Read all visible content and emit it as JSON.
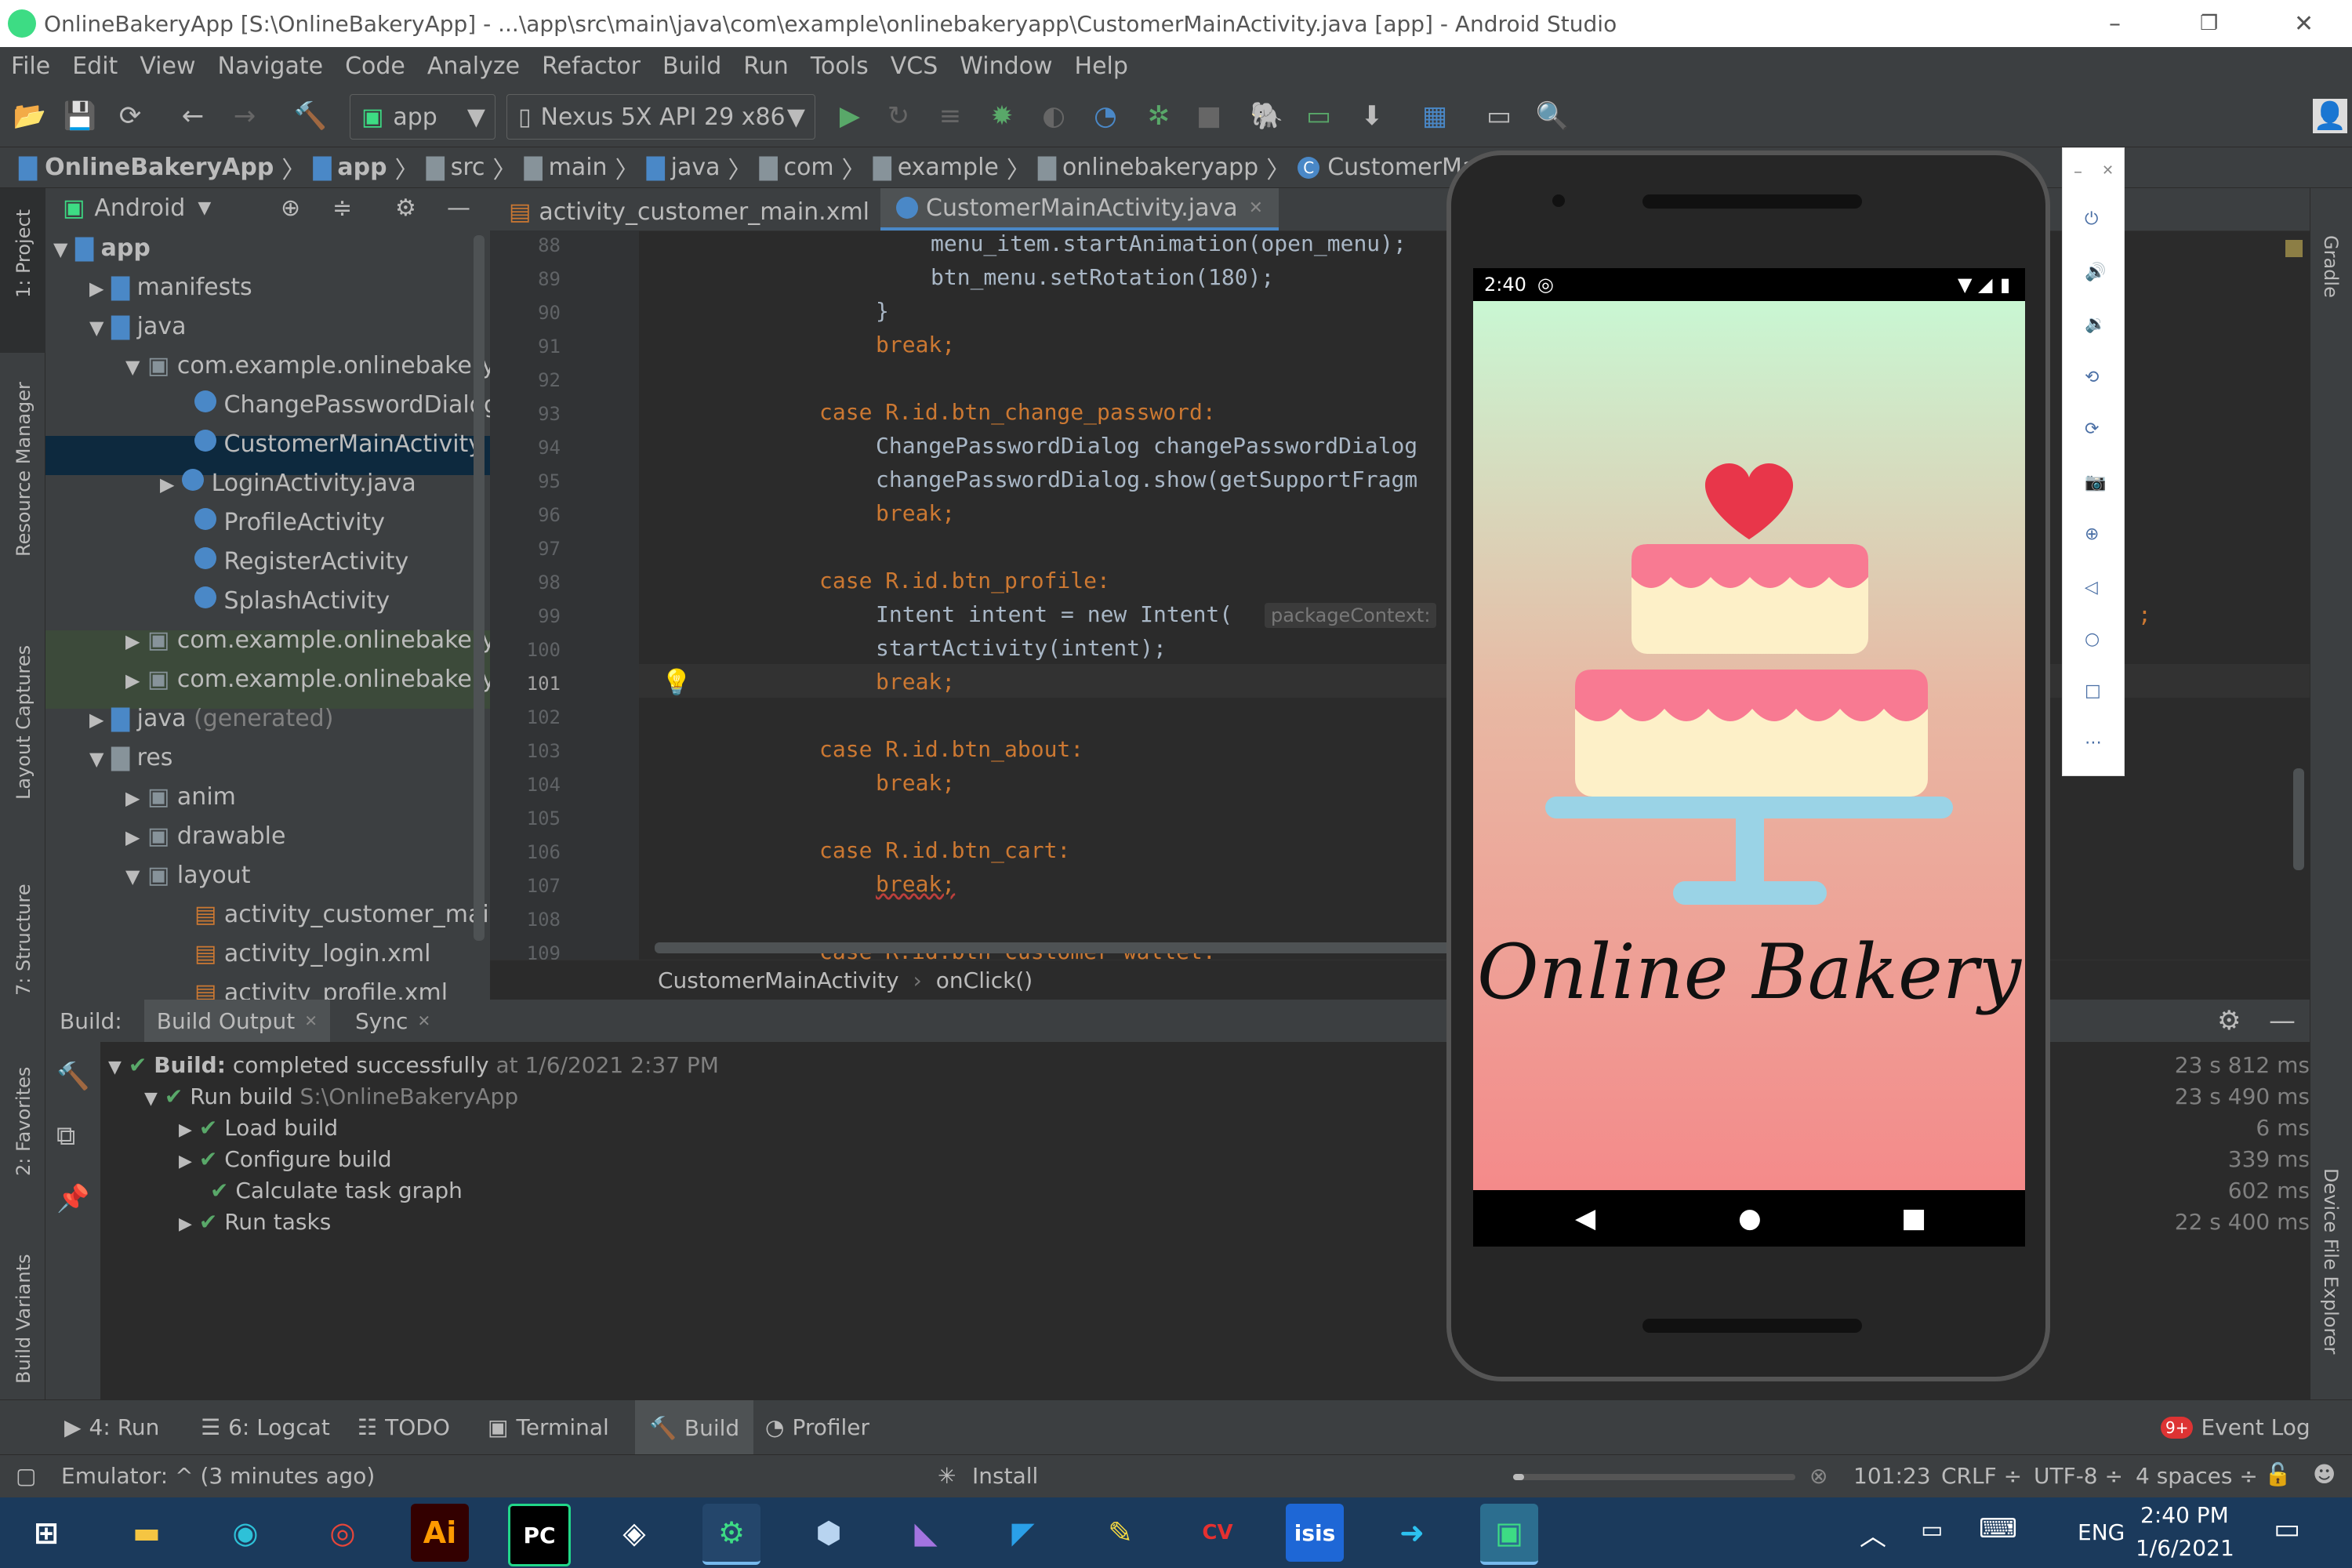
{
  "window": {
    "title": "OnlineBakeryApp [S:\\OnlineBakeryApp] - ...\\app\\src\\main\\java\\com\\example\\onlinebakeryapp\\CustomerMainActivity.java [app] - Android Studio",
    "minimize": "–",
    "maximize": "❐",
    "close": "✕"
  },
  "menu": [
    "File",
    "Edit",
    "View",
    "Navigate",
    "Code",
    "Analyze",
    "Refactor",
    "Build",
    "Run",
    "Tools",
    "VCS",
    "Window",
    "Help"
  ],
  "toolbar": {
    "config": "app",
    "device": "Nexus 5X API 29 x86"
  },
  "breadcrumb": [
    "OnlineBakeryApp",
    "app",
    "src",
    "main",
    "java",
    "com",
    "example",
    "onlinebakeryapp",
    "CustomerMainActivity"
  ],
  "project": {
    "view": "Android",
    "items": [
      {
        "label": "app"
      },
      {
        "label": "manifests"
      },
      {
        "label": "java"
      },
      {
        "label": "com.example.onlinebakeryap"
      },
      {
        "label": "ChangePasswordDialog"
      },
      {
        "label": "CustomerMainActivity"
      },
      {
        "label": "LoginActivity.java"
      },
      {
        "label": "ProfileActivity"
      },
      {
        "label": "RegisterActivity"
      },
      {
        "label": "SplashActivity"
      },
      {
        "label": "com.example.onlinebakeryap"
      },
      {
        "label": "com.example.onlinebakeryap"
      },
      {
        "label": "java",
        "suffix": "(generated)"
      },
      {
        "label": "res"
      },
      {
        "label": "anim"
      },
      {
        "label": "drawable"
      },
      {
        "label": "layout"
      },
      {
        "label": "activity_customer_main.xr"
      },
      {
        "label": "activity_login.xml"
      },
      {
        "label": "activity_profile.xml"
      }
    ]
  },
  "left_tool_windows": [
    "1: Project",
    "Resource Manager",
    "Layout Captures",
    "7: Structure",
    "2: Favorites",
    "Build Variants"
  ],
  "right_tool_windows": [
    "Gradle",
    "Device File Explorer"
  ],
  "editor": {
    "tabs": [
      {
        "label": "activity_customer_main.xml",
        "close": "✕"
      },
      {
        "label": "CustomerMainActivity.java",
        "close": "✕"
      }
    ],
    "lines": [
      {
        "n": "88",
        "text": "menu_item.startAnimation(open_menu);"
      },
      {
        "n": "89",
        "text": "btn_menu.setRotation(180);"
      },
      {
        "n": "90",
        "text": "}"
      },
      {
        "n": "91",
        "text": "break;"
      },
      {
        "n": "92",
        "text": ""
      },
      {
        "n": "93",
        "text": "case R.id.btn_change_password:"
      },
      {
        "n": "94",
        "text": "ChangePasswordDialog changePasswordDialog"
      },
      {
        "n": "95",
        "text": "changePasswordDialog.show(getSupportFragm"
      },
      {
        "n": "96",
        "text": "break;"
      },
      {
        "n": "97",
        "text": ""
      },
      {
        "n": "98",
        "text": "case R.id.btn_profile:"
      },
      {
        "n": "99",
        "text": "Intent intent = new Intent("
      },
      {
        "n": "100",
        "text": "startActivity(intent);"
      },
      {
        "n": "101",
        "text": "break;"
      },
      {
        "n": "102",
        "text": ""
      },
      {
        "n": "103",
        "text": "case R.id.btn_about:"
      },
      {
        "n": "104",
        "text": "break;"
      },
      {
        "n": "105",
        "text": ""
      },
      {
        "n": "106",
        "text": "case R.id.btn_cart:"
      },
      {
        "n": "107",
        "text": "break;"
      },
      {
        "n": "108",
        "text": ""
      },
      {
        "n": "109",
        "text": "case R.id.btn_customer_wallet:"
      }
    ],
    "hint": "packageContext:",
    "trailing": ";",
    "crumbs": [
      "CustomerMainActivity",
      "onClick()"
    ]
  },
  "build": {
    "label": "Build:",
    "tabs": [
      "Build Output",
      "Sync"
    ],
    "tab_close": "✕",
    "rows": [
      {
        "bold": "Build:",
        "text": " completed successfully",
        "dim": " at 1/6/2021 2:37 PM",
        "time": "23 s 812 ms"
      },
      {
        "text": "Run build",
        "dim": " S:\\OnlineBakeryApp",
        "time": "23 s 490 ms"
      },
      {
        "text": "Load build",
        "time": "6 ms"
      },
      {
        "text": "Configure build",
        "time": "339 ms"
      },
      {
        "text": "Calculate task graph",
        "time": "602 ms"
      },
      {
        "text": "Run tasks",
        "time": "22 s 400 ms"
      }
    ]
  },
  "bottom_tabs": [
    {
      "icon": "play-icon",
      "label": "4: Run"
    },
    {
      "icon": "logcat-icon",
      "label": "6: Logcat"
    },
    {
      "icon": "todo-icon",
      "label": "TODO"
    },
    {
      "icon": "terminal-icon",
      "label": "Terminal"
    },
    {
      "icon": "build-hammer-icon",
      "label": "Build"
    },
    {
      "icon": "profiler-icon",
      "label": "Profiler"
    }
  ],
  "event_log": {
    "badge": "9+",
    "label": "Event Log"
  },
  "status": {
    "message": "Emulator: ^ (3 minutes ago)",
    "task": "Install",
    "position": "101:23",
    "line_sep": "CRLF ÷",
    "encoding": "UTF-8 ÷",
    "indent": "4 spaces ÷"
  },
  "emulator": {
    "time": "2:40",
    "app_title": "Online Bakery",
    "controls": [
      "power-icon",
      "volume-up-icon",
      "volume-down-icon",
      "rotate-left-icon",
      "rotate-right-icon",
      "camera-icon",
      "zoom-icon",
      "back-icon",
      "home-icon",
      "overview-icon",
      "more-icon"
    ]
  },
  "taskbar": {
    "apps": [
      "windows-start",
      "file-explorer",
      "edge",
      "chrome",
      "illustrator",
      "pycharm",
      "unity",
      "android-studio",
      "box-app",
      "visual-studio",
      "vscode",
      "sticky-app",
      "cvavr",
      "isis",
      "remote-app",
      "notepad-app"
    ],
    "lang": "ENG",
    "time": "2:40 PM",
    "date": "1/6/2021"
  },
  "colors": {
    "accent": "#4a88c7",
    "success": "#59a869",
    "keyword": "#cc7832",
    "field": "#9876aa"
  }
}
